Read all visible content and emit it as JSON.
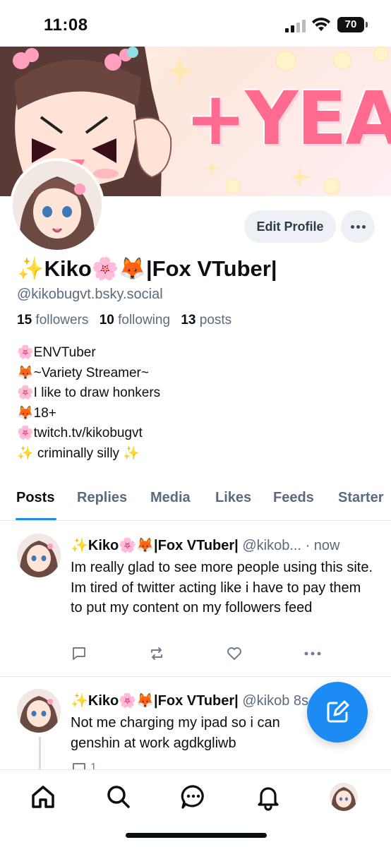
{
  "status_bar": {
    "time": "11:08",
    "battery": "70"
  },
  "banner": {
    "text": "+YEAH"
  },
  "profile": {
    "edit_label": "Edit Profile",
    "display_name": "✨Kiko🌸🦊|Fox VTuber|",
    "handle": "@kikobugvt.bsky.social",
    "stats": {
      "followers_count": "15",
      "followers_label": "followers",
      "following_count": "10",
      "following_label": "following",
      "posts_count": "13",
      "posts_label": "posts"
    },
    "bio": [
      "🌸ENVTuber",
      "🦊~Variety Streamer~",
      "🌸I like to draw honkers",
      "🦊18+",
      "🌸twitch.tv/kikobugvt",
      "✨ criminally silly ✨"
    ]
  },
  "tabs": [
    "Posts",
    "Replies",
    "Media",
    "Likes",
    "Feeds",
    "Starter"
  ],
  "posts": [
    {
      "author": "✨Kiko🌸🦊|Fox VTuber|",
      "handle": "@kikob...",
      "time": "· now",
      "text": "Im really glad to see more people using this site. Im tired of twitter acting like i have to pay them to put my content on my followers feed",
      "reply_count": "",
      "repost_count": "",
      "like_count": ""
    },
    {
      "author": "✨Kiko🌸🦊|Fox VTuber|",
      "handle": "@kikob",
      "time": "8s",
      "text": "Not me charging my ipad so i can genshin at work agdkgliwb",
      "reply_count": "1",
      "repost_count": "",
      "like_count": ""
    }
  ],
  "colors": {
    "accent": "#1c8bf3",
    "muted": "#5b6b7d",
    "banner_text": "#ff6b8e"
  },
  "icons": {
    "nav": [
      "home-icon",
      "search-icon",
      "chat-icon",
      "bell-icon",
      "profile-avatar"
    ],
    "fab": "compose-icon"
  }
}
